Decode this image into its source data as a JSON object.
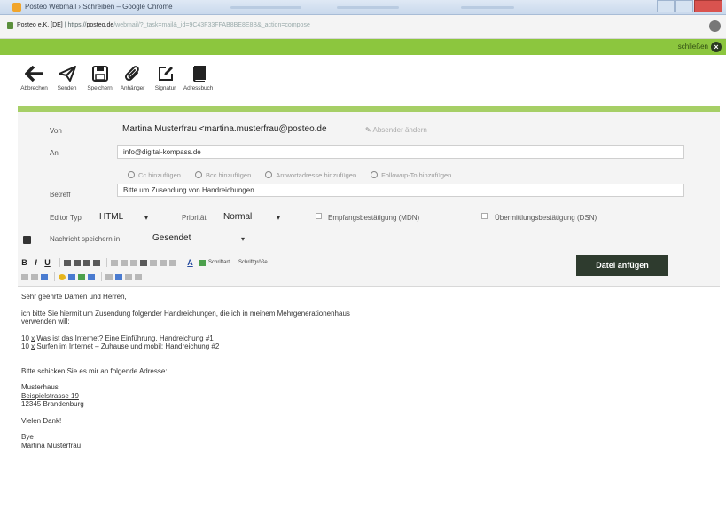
{
  "window": {
    "title": "Posteo Webmail › Schreiben – Google Chrome"
  },
  "address_bar": {
    "host": "Posteo e.K. [DE]",
    "scheme": "https://",
    "domain": "posteo.de",
    "path": "/webmail/?_task=mail&_id=9C43F33FFAB8BE8E8B&_action=compose"
  },
  "top_bar": {
    "close_label": "schließen"
  },
  "toolbar": {
    "items": [
      {
        "label": "Abbrechen",
        "icon": "back-arrow-icon"
      },
      {
        "label": "Senden",
        "icon": "paper-plane-icon"
      },
      {
        "label": "Speichern",
        "icon": "floppy-icon"
      },
      {
        "label": "Anhänger",
        "icon": "paperclip-icon"
      },
      {
        "label": "Signatur",
        "icon": "pencil-square-icon"
      },
      {
        "label": "Adressbuch",
        "icon": "book-icon"
      }
    ]
  },
  "compose": {
    "from_label": "Von",
    "from_value": "Martina Musterfrau <martina.musterfrau@posteo.de",
    "change_sender": "Absender ändern",
    "to_label": "An",
    "to_value": "info@digital-kompass.de",
    "add_links": [
      "Cc hinzufügen",
      "Bcc hinzufügen",
      "Antwortadresse hinzufügen",
      "Followup-To hinzufügen"
    ],
    "subject_label": "Betreff",
    "subject_value": "Bitte um Zusendung von Handreichungen",
    "editor_type_label": "Editor Typ",
    "editor_type_value": "HTML",
    "priority_label": "Priorität",
    "priority_value": "Normal",
    "receipt_label": "Empfangsbestätigung (MDN)",
    "delivery_label": "Übermittlungsbestätigung (DSN)",
    "save_in_label": "Nachricht speichern in",
    "save_in_value": "Gesendet",
    "attach_button": "Datei anfügen"
  },
  "editor_toolbar": {
    "font_select": "Schriftart",
    "size_select": "Schriftgröße"
  },
  "body": {
    "greeting": "Sehr geehrte Damen und Herren,",
    "intro_1": "ich bitte Sie hiermit um Zusendung folgender Handreichungen, die ich in meinem Mehrgenerationenhaus",
    "intro_2": "verwenden will:",
    "item_1_qty": "10",
    "item_1_x": "x",
    "item_1_text": "Was ist das Internet? Eine Einführung, Handreichung #1",
    "item_2_qty": "10",
    "item_2_x": "x",
    "item_2_text": "Surfen im Internet – Zuhause und mobil; Handreichung #2",
    "request": "Bitte schicken Sie es mir an folgende Adresse:",
    "addr_1": "Musterhaus",
    "addr_2": "Beispielstrasse 19",
    "addr_3": "12345 Brandenburg",
    "thanks": "Vielen Dank!",
    "bye": "Bye",
    "signature": "Martina Musterfrau"
  },
  "colors": {
    "accent_green": "#8cc63e",
    "attach_button_bg": "#2e3b2e"
  }
}
